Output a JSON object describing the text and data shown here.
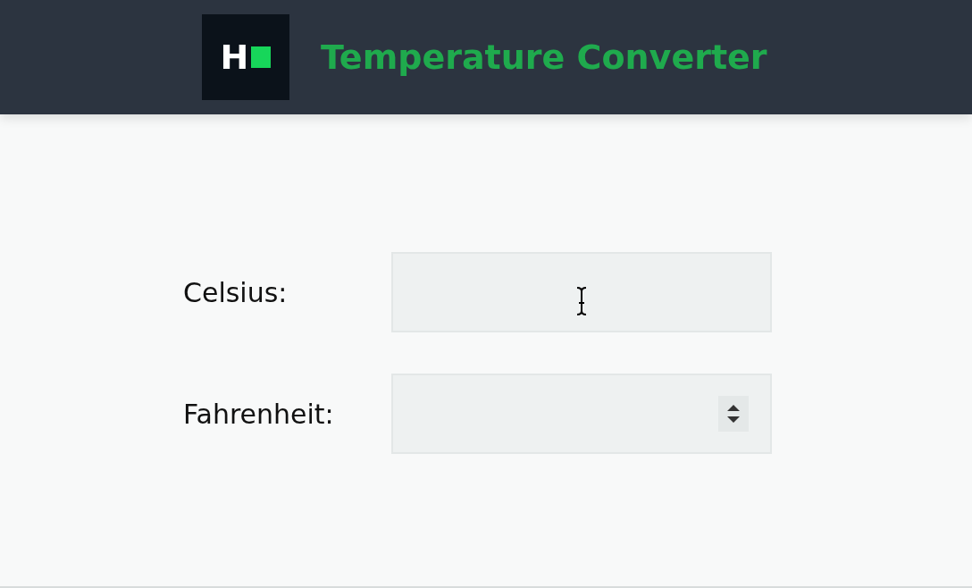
{
  "header": {
    "logo_letter": "H",
    "title": "Temperature Converter"
  },
  "fields": [
    {
      "label": "Celsius:",
      "kind": "text",
      "hovered": true
    },
    {
      "label": "Fahrenheit:",
      "kind": "number",
      "hovered": false
    }
  ]
}
